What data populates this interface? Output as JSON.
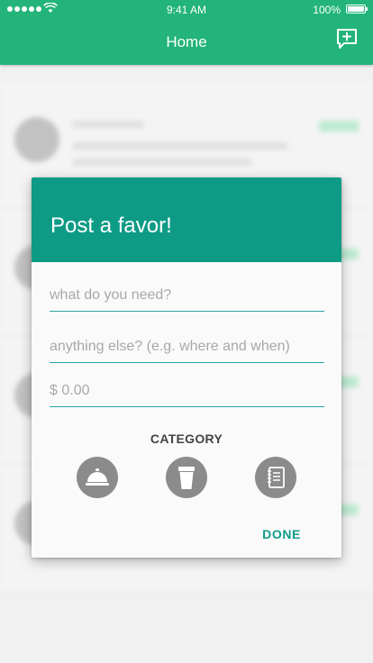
{
  "status_bar": {
    "time": "9:41 AM",
    "battery": "100%"
  },
  "app_bar": {
    "title": "Home",
    "action_icon": "compose-chat-plus-icon"
  },
  "dialog": {
    "title": "Post a favor!",
    "need_placeholder": "what do you need?",
    "details_placeholder": "anything else? (e.g. where and when)",
    "price_placeholder": "$ 0.00",
    "category_label": "CATEGORY",
    "categories": [
      {
        "icon": "service-bell-icon"
      },
      {
        "icon": "coffee-cup-icon"
      },
      {
        "icon": "notebook-icon"
      }
    ],
    "done_label": "DONE"
  },
  "colors": {
    "app_bar": "#22b47a",
    "dialog_header": "#0d9b86",
    "accent": "#119c8a",
    "category_button": "#8b8b8b"
  }
}
